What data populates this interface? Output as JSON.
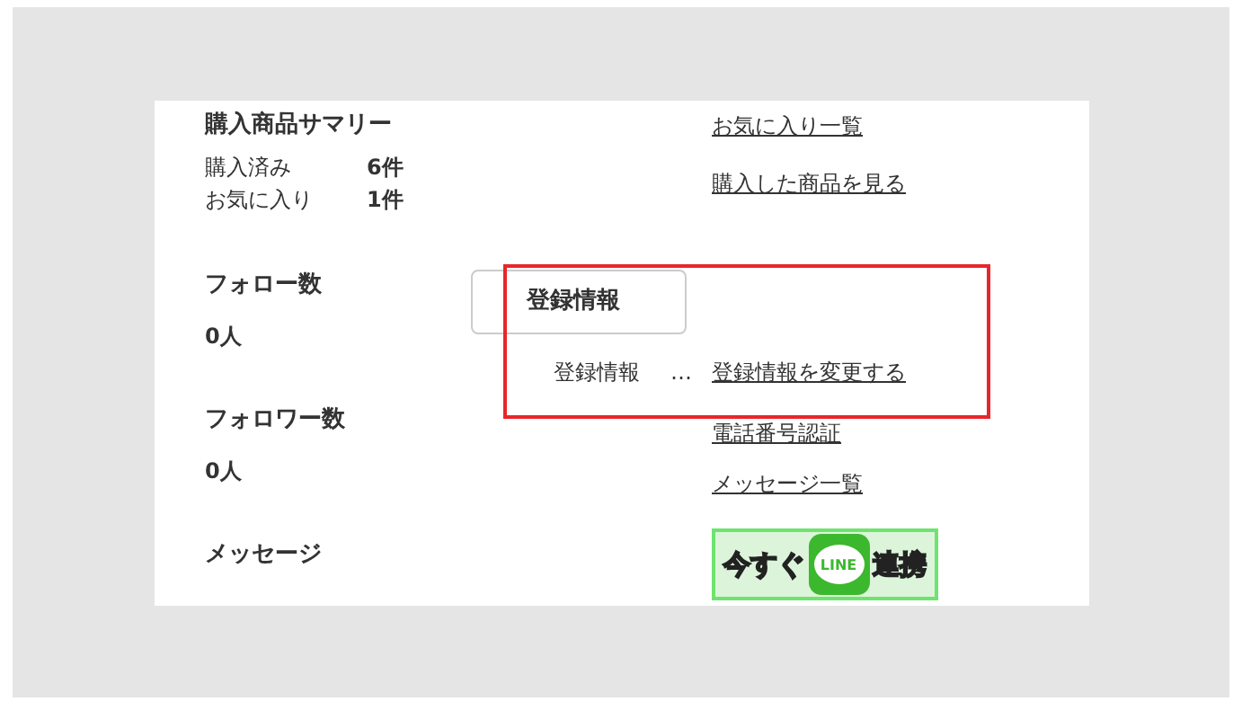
{
  "summary": {
    "title": "購入商品サマリー",
    "rows": [
      {
        "label": "購入済み",
        "value": "6件"
      },
      {
        "label": "お気に入り",
        "value": "1件"
      }
    ]
  },
  "stats": [
    {
      "title": "フォロー数",
      "value": "0人"
    },
    {
      "title": "フォロワー数",
      "value": "0人"
    },
    {
      "title": "メッセージ"
    }
  ],
  "links": [
    {
      "kind": "link",
      "text": "お気に入り一覧"
    },
    {
      "kind": "link",
      "text": "購入した商品を見る"
    },
    {
      "kind": "registration",
      "label": "登録情報",
      "separator": "…",
      "link": "登録情報を変更する"
    },
    {
      "kind": "link",
      "text": "電話番号認証"
    },
    {
      "kind": "link",
      "text": "メッセージ一覧"
    },
    {
      "kind": "line_banner",
      "before": "今すぐ",
      "logo": "LINE",
      "after": "連携"
    }
  ],
  "tooltip": {
    "text": "登録情報"
  }
}
